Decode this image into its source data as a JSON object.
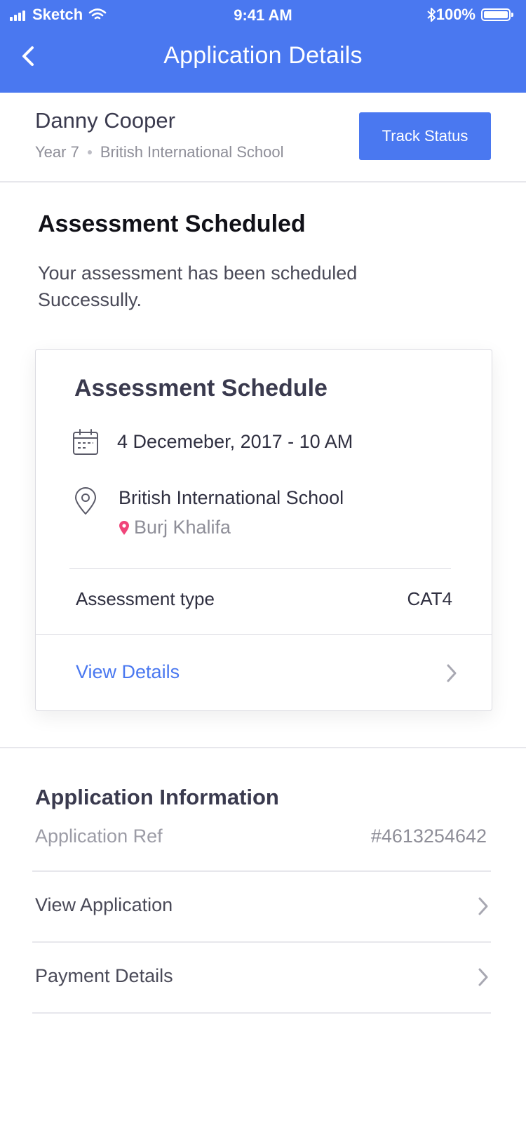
{
  "status_bar": {
    "carrier": "Sketch",
    "time": "9:41 AM",
    "battery": "100%"
  },
  "nav": {
    "title": "Application Details"
  },
  "student": {
    "name": "Danny Cooper",
    "year": "Year 7",
    "school": "British International School",
    "track_button": "Track Status"
  },
  "status": {
    "title": "Assessment Scheduled",
    "description": "Your assessment has been scheduled Successully."
  },
  "schedule_card": {
    "title": "Assessment Schedule",
    "date": "4 Decemeber, 2017 - 10 AM",
    "school": "British International School",
    "location": "Burj Khalifa",
    "type_label": "Assessment type",
    "type_value": "CAT4",
    "view_details": "View Details"
  },
  "application_info": {
    "title": "Application Information",
    "ref_label": "Application Ref",
    "ref_value": "#4613254642",
    "rows": [
      {
        "label": "View Application"
      },
      {
        "label": "Payment Details"
      }
    ]
  },
  "colors": {
    "primary": "#4a78f0",
    "location_pin": "#f0457a"
  }
}
